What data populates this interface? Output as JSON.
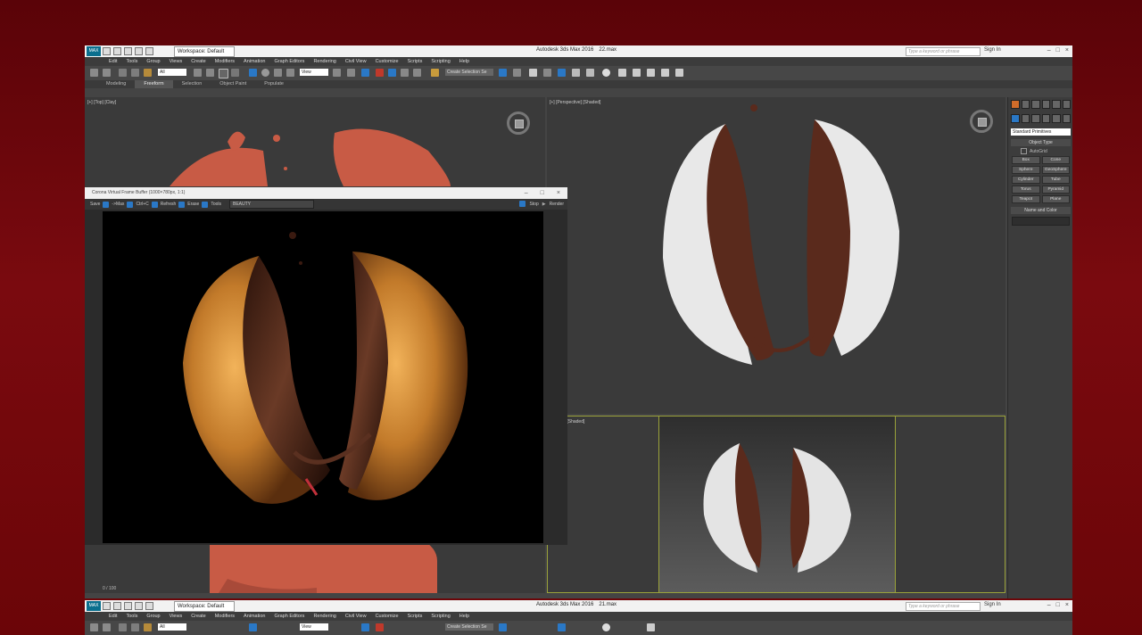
{
  "app": {
    "logo": "MAX",
    "workspace": "Workspace: Default",
    "title": "Autodesk 3ds Max 2016",
    "file": "22.max",
    "search_placeholder": "Type a keyword or phrase",
    "sign_in": "Sign In",
    "menu": [
      "Edit",
      "Tools",
      "Group",
      "Views",
      "Create",
      "Modifiers",
      "Animation",
      "Graph Editors",
      "Rendering",
      "Civil View",
      "Customize",
      "Scripts",
      "Scripting",
      "Help"
    ],
    "toolbar": {
      "filter": "All",
      "view": "View",
      "selection_set": "Create Selection Se"
    },
    "ribbon_tabs": [
      "Modeling",
      "Freeform",
      "Selection",
      "Object Paint",
      "Populate"
    ]
  },
  "viewports": {
    "top_label": "[+] [Top] [Clay]",
    "perspective_label": "[+] [Perspective] [Shaded]",
    "camera_label": "era001] [Shaded]"
  },
  "command_panel": {
    "dropdown": "Standard Primitives",
    "object_type_title": "Object Type",
    "autogrid": "AutoGrid",
    "buttons": [
      "Box",
      "Cone",
      "Sphere",
      "GeoSphere",
      "Cylinder",
      "Tube",
      "Torus",
      "Pyramid",
      "Teapot",
      "Plane"
    ],
    "name_color_title": "Name and Color"
  },
  "vfb": {
    "title": "Corona Virtual Frame Buffer (1000×780px, 1:1)",
    "tools": [
      "Save",
      "->Max",
      "Ctrl+C",
      "Refresh",
      "Erase",
      "Tools"
    ],
    "channel": "BEAUTY",
    "stop": "Stop",
    "render": "Render"
  },
  "timeline": {
    "frame": "0 / 100"
  },
  "second_window": {
    "workspace": "Workspace: Default",
    "title": "Autodesk 3ds Max 2016",
    "file": "21.max",
    "search_placeholder": "Type a keyword or phrase",
    "sign_in": "Sign In",
    "menu": [
      "Edit",
      "Tools",
      "Group",
      "Views",
      "Create",
      "Modifiers",
      "Animation",
      "Graph Editors",
      "Rendering",
      "Civil View",
      "Customize",
      "Scripts",
      "Scripting",
      "Help"
    ],
    "toolbar": {
      "filter": "All",
      "view": "View",
      "selection_set": "Create Selection Se"
    }
  },
  "colors": {
    "backdrop": "#6b0508",
    "accent": "#2a78c6",
    "viewport": "#3a3a3a"
  }
}
